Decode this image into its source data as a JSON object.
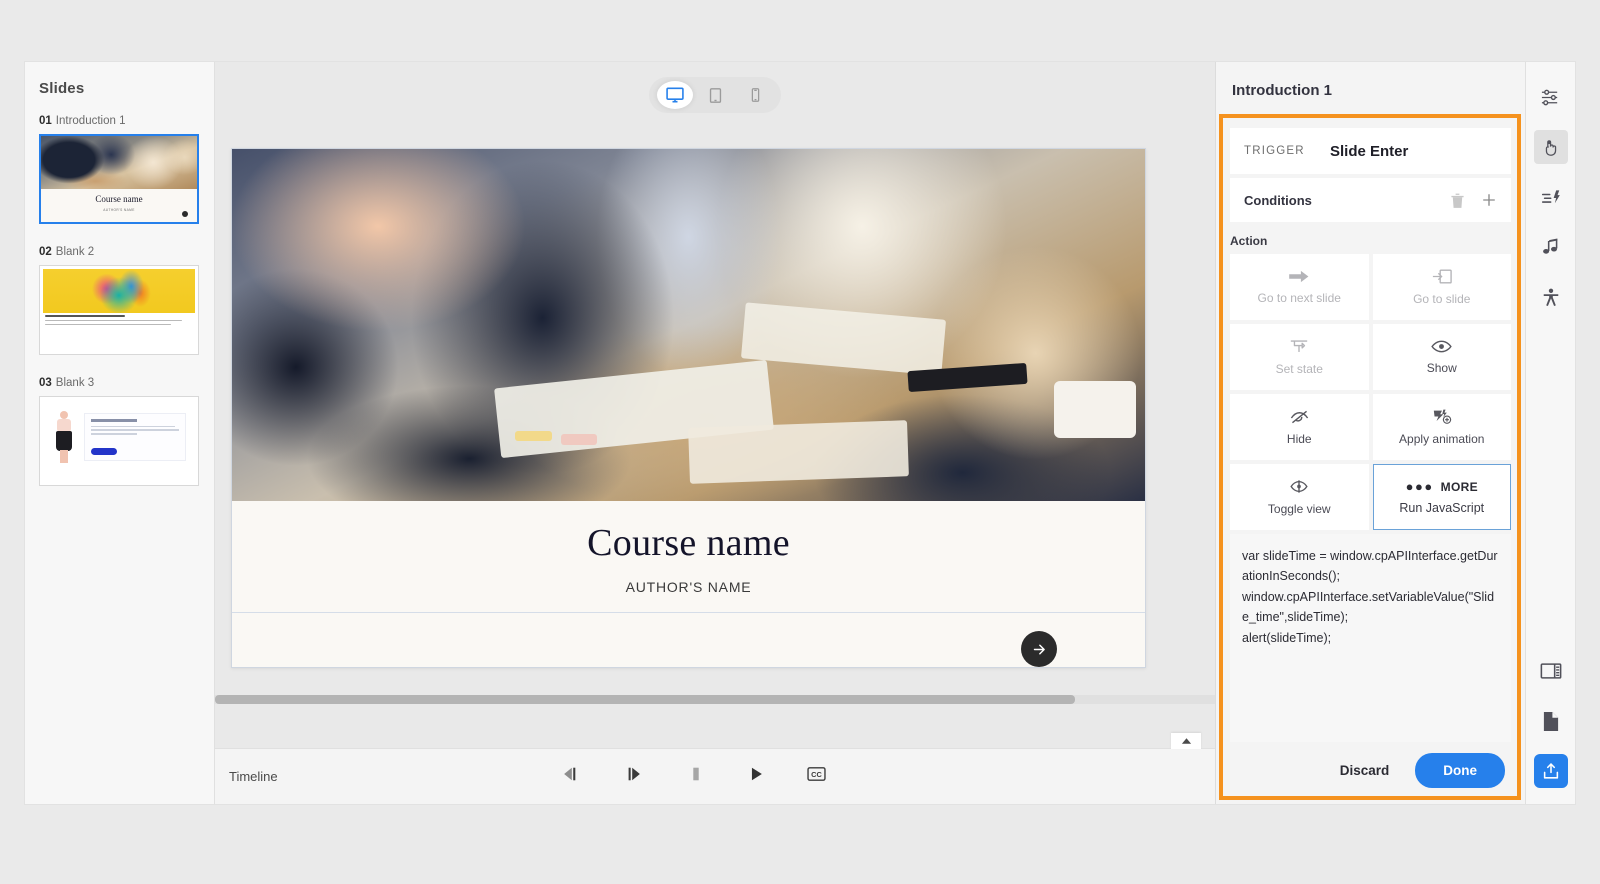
{
  "slides_panel": {
    "title": "Slides",
    "items": [
      {
        "number": "01",
        "name": "Introduction 1",
        "selected": true,
        "thumb_title": "Course name",
        "thumb_subtitle": "AUTHOR'S NAME"
      },
      {
        "number": "02",
        "name": "Blank 2",
        "selected": false
      },
      {
        "number": "03",
        "name": "Blank 3",
        "selected": false
      }
    ]
  },
  "device_bar": {
    "options": [
      {
        "icon": "desktop-icon",
        "label": "Desktop",
        "active": true
      },
      {
        "icon": "tablet-icon",
        "label": "Tablet",
        "active": false
      },
      {
        "icon": "mobile-icon",
        "label": "Mobile",
        "active": false
      }
    ]
  },
  "canvas": {
    "title": "Course name",
    "subtitle": "AUTHOR'S NAME",
    "next_button_icon": "arrow-right-icon"
  },
  "timeline": {
    "label": "Timeline",
    "controls": [
      {
        "icon": "step-back-icon",
        "label": "Step back"
      },
      {
        "icon": "step-forward-icon",
        "label": "Step forward"
      },
      {
        "icon": "stop-icon",
        "label": "Stop"
      },
      {
        "icon": "play-icon",
        "label": "Play"
      },
      {
        "icon": "cc-icon",
        "label": "Closed captions"
      }
    ],
    "collapse_icon": "chevron-up-icon"
  },
  "interactions_panel": {
    "header": "Introduction 1",
    "trigger": {
      "label": "TRIGGER",
      "value": "Slide Enter"
    },
    "conditions": {
      "label": "Conditions",
      "delete_icon": "trash-icon",
      "add_icon": "plus-icon"
    },
    "action_section_label": "Action",
    "actions": [
      {
        "label": "Go to next slide",
        "icon": "arrow-right-icon",
        "state": "dim"
      },
      {
        "label": "Go to slide",
        "icon": "enter-slide-icon",
        "state": "dim"
      },
      {
        "label": "Set state",
        "icon": "set-state-icon",
        "state": "dim"
      },
      {
        "label": "Show",
        "icon": "eye-icon",
        "state": "normal"
      },
      {
        "label": "Hide",
        "icon": "eye-off-icon",
        "state": "normal"
      },
      {
        "label": "Apply animation",
        "icon": "animation-icon",
        "state": "normal"
      },
      {
        "label": "Toggle view",
        "icon": "toggle-view-icon",
        "state": "normal"
      }
    ],
    "more_action": {
      "dots": "●●●",
      "more_label": "MORE",
      "sub_label": "Run JavaScript",
      "selected": true
    },
    "script": "var slideTime = window.cpAPIInterface.getDurationInSeconds();\nwindow.cpAPIInterface.setVariableValue(\"Slide_time\",slideTime);\nalert(slideTime);",
    "footer": {
      "discard": "Discard",
      "done": "Done"
    },
    "highlight_color": "#f5921e"
  },
  "rail": {
    "top_items": [
      {
        "icon": "properties-sliders-icon",
        "label": "Properties",
        "active": false
      },
      {
        "icon": "interactions-hand-icon",
        "label": "Interactions",
        "active": true
      },
      {
        "icon": "timing-animation-icon",
        "label": "Timing",
        "active": false
      },
      {
        "icon": "audio-music-icon",
        "label": "Audio",
        "active": false
      },
      {
        "icon": "accessibility-icon",
        "label": "Accessibility",
        "active": false
      }
    ],
    "bottom_items": [
      {
        "icon": "panel-layout-icon",
        "label": "Layout",
        "active": false
      },
      {
        "icon": "document-page-icon",
        "label": "Document",
        "active": false
      },
      {
        "icon": "publish-upload-icon",
        "label": "Publish",
        "active": false,
        "accent": "#2680eb"
      }
    ]
  }
}
